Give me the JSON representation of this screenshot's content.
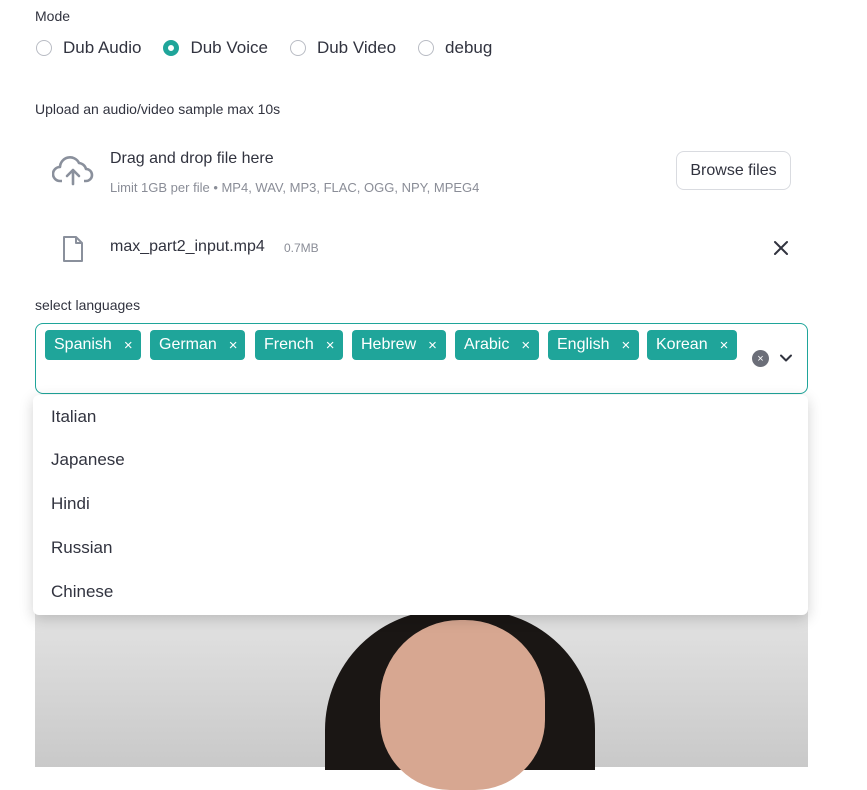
{
  "mode": {
    "label": "Mode",
    "options": [
      "Dub Audio",
      "Dub Voice",
      "Dub Video",
      "debug"
    ],
    "selected": "Dub Voice"
  },
  "uploader": {
    "label": "Upload an audio/video sample max 10s",
    "drop_title": "Drag and drop file here",
    "drop_subtitle": "Limit 1GB per file • MP4, WAV, MP3, FLAC, OGG, NPY, MPEG4",
    "browse_label": "Browse files",
    "icon": "cloud-upload-icon"
  },
  "uploaded_file": {
    "name": "max_part2_input.mp4",
    "size": "0.7MB",
    "icon": "file-icon"
  },
  "languages": {
    "label": "select languages",
    "selected": [
      "Spanish",
      "German",
      "French",
      "Hebrew",
      "Arabic",
      "English",
      "Korean"
    ],
    "remove_glyph": "×",
    "options": [
      "Italian",
      "Japanese",
      "Hindi",
      "Russian",
      "Chinese"
    ]
  },
  "colors": {
    "accent": "#1fa59a",
    "text": "#31333f",
    "muted": "#8a8d97"
  }
}
